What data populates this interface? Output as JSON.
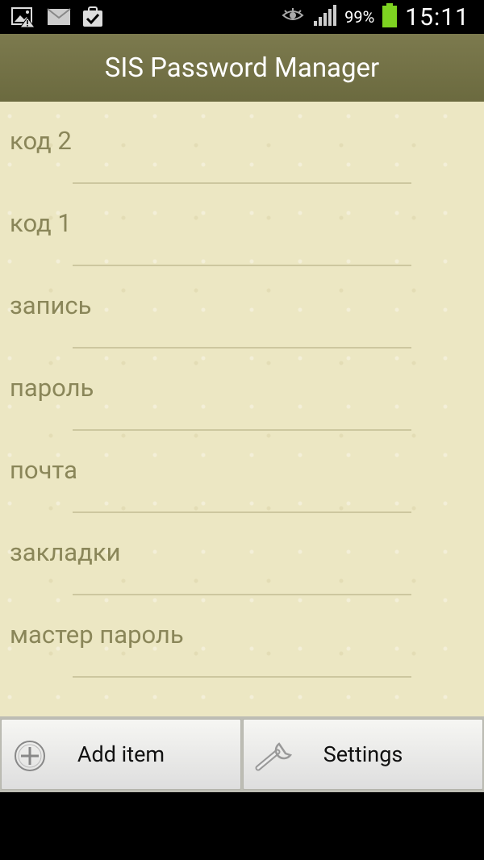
{
  "status_bar": {
    "battery_percent": "99%",
    "time": "15:11",
    "icons": [
      "gallery-alert-icon",
      "email-icon",
      "checkbox-icon",
      "eye-icon",
      "signal-icon",
      "battery-icon"
    ]
  },
  "app_bar": {
    "title": "SIS Password Manager"
  },
  "list": {
    "items": [
      {
        "label": "код 2"
      },
      {
        "label": "код 1"
      },
      {
        "label": "запись"
      },
      {
        "label": "пароль"
      },
      {
        "label": "почта"
      },
      {
        "label": "закладки"
      },
      {
        "label": "мастер пароль"
      }
    ]
  },
  "bottom_bar": {
    "add_label": "Add item",
    "settings_label": "Settings"
  },
  "colors": {
    "app_bar": "#726f45",
    "list_background": "#ece7c3",
    "list_text": "#8a8659",
    "battery": "#7ed321"
  }
}
